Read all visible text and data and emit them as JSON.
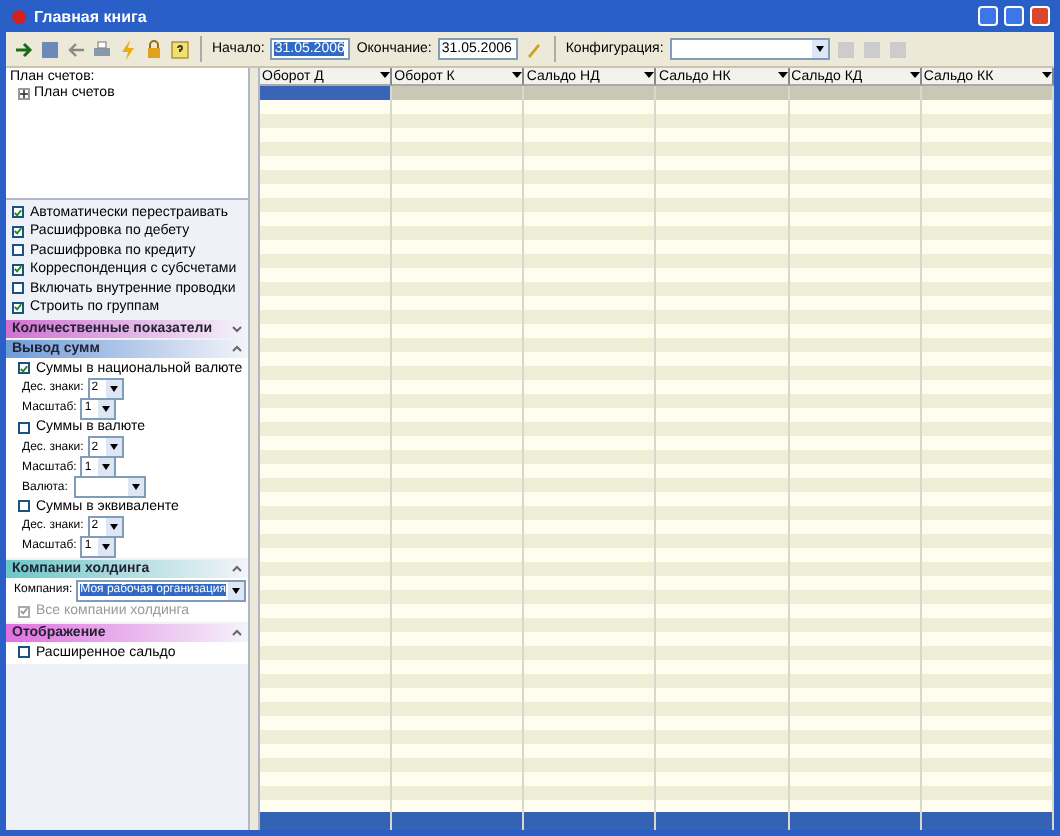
{
  "window": {
    "title": "Главная книга"
  },
  "toolbar": {
    "start_label": "Начало:",
    "start_value": "31.05.2006",
    "start_selected": true,
    "end_label": "Окончание:",
    "end_value": "31.05.2006",
    "config_label": "Конфигурация:"
  },
  "tree": {
    "header": "План счетов:",
    "items": [
      {
        "label": "План счетов",
        "expanded": false
      }
    ]
  },
  "options": [
    {
      "label": "Автоматически перестраивать",
      "checked": true
    },
    {
      "label": "Расшифровка по дебету",
      "checked": true
    },
    {
      "label": "Расшифровка по кредиту",
      "checked": false
    },
    {
      "label": "Корреспонденция с субсчетами",
      "checked": true
    },
    {
      "label": "Включать внутренние проводки",
      "checked": false
    },
    {
      "label": "Строить по группам",
      "checked": true
    }
  ],
  "sections": [
    {
      "title": "Количественные показатели",
      "color": "#d070d0",
      "expanded": false
    },
    {
      "title": "Вывод сумм",
      "color": "#6f9bd8",
      "expanded": true,
      "items": [
        {
          "kind": "checkbox",
          "label": "Суммы в национальной валюте",
          "checked": true,
          "disabled": false
        },
        {
          "kind": "select",
          "label": "Дес. знаки:",
          "value": "2"
        },
        {
          "kind": "select",
          "label": "Масштаб:",
          "value": "1"
        },
        {
          "kind": "checkbox",
          "label": "Суммы в валюте",
          "checked": false,
          "disabled": false
        },
        {
          "kind": "select",
          "label": "Дес. знаки:",
          "value": "2"
        },
        {
          "kind": "select",
          "label": "Масштаб:",
          "value": "1"
        },
        {
          "kind": "wideselect",
          "label": "Валюта:",
          "value": ""
        },
        {
          "kind": "checkbox",
          "label": "Суммы в эквиваленте",
          "checked": false,
          "disabled": false
        },
        {
          "kind": "select",
          "label": "Дес. знаки:",
          "value": "2"
        },
        {
          "kind": "select",
          "label": "Масштаб:",
          "value": "1"
        }
      ]
    },
    {
      "title": "Компании холдинга",
      "color": "#6cc6c6",
      "expanded": true,
      "items": [
        {
          "kind": "company",
          "label": "Компания:",
          "value": "Моя рабочая организация"
        },
        {
          "kind": "checkbox",
          "label": "Все компании холдинга",
          "checked": true,
          "disabled": true
        }
      ]
    },
    {
      "title": "Отображение",
      "color": "#e070e0",
      "expanded": true,
      "items": [
        {
          "kind": "checkbox",
          "label": "Расширенное сальдо",
          "checked": false,
          "disabled": false
        }
      ]
    }
  ],
  "grid": {
    "columns": [
      {
        "label": "Оборот Д",
        "selected": true
      },
      {
        "label": "Оборот К",
        "selected": false
      },
      {
        "label": "Сальдо НД",
        "selected": false
      },
      {
        "label": "Сальдо НК",
        "selected": false
      },
      {
        "label": "Сальдо КД",
        "selected": false
      },
      {
        "label": "Сальдо КК",
        "selected": false
      }
    ]
  }
}
